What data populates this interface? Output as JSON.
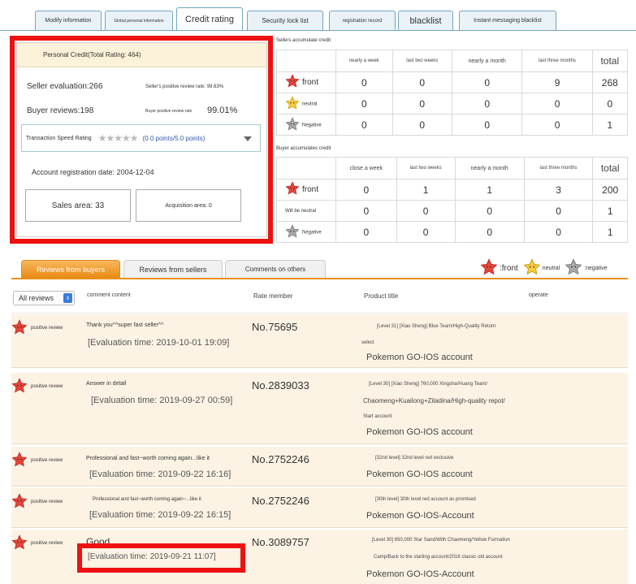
{
  "top_tabs": [
    {
      "label": "Modify information"
    },
    {
      "label": "Global personal information"
    },
    {
      "label": "Credit rating"
    },
    {
      "label": "Security lock list"
    },
    {
      "label": "registration record"
    },
    {
      "label": "blacklist"
    },
    {
      "label": "Instant messaging blacklist"
    }
  ],
  "summary": {
    "title": "Personal Credit(Total Rating: 464)",
    "seller_eval": "Seller evaluation:266",
    "seller_rate_label": "Seller's positive review rate: 99.63%",
    "buyer_reviews": "Buyer reviews:198",
    "buyer_rate_label": "Buyer positive review rate",
    "buyer_rate": "99.01%",
    "speed_label": "Transaction Speed Rating",
    "speed_value": "(0.0 points/5.0 points)",
    "speed_stars": 0,
    "reg_date": "Account registration date: 2004-12-04",
    "sales_area": "Sales area: 33",
    "acq_area": "Acquisition area: 0"
  },
  "seller_credit": {
    "title": "Sellers accumulate credit",
    "headers": [
      "nearly a week",
      "last two weeks",
      "nearly a month",
      "last three months",
      "total"
    ],
    "rows": [
      {
        "label": "front",
        "icon": "red-star-icon",
        "values": [
          "0",
          "0",
          "0",
          "9",
          "268"
        ]
      },
      {
        "label": "neutral",
        "icon": "yellow-star-icon",
        "values": [
          "0",
          "0",
          "0",
          "0",
          "0"
        ]
      },
      {
        "label": "Negative",
        "icon": "gray-star-icon",
        "values": [
          "0",
          "0",
          "0",
          "0",
          "1"
        ]
      }
    ]
  },
  "buyer_credit": {
    "title": "Buyer accumulates credit",
    "headers": [
      "close a week",
      "last two weeks",
      "nearly a month",
      "last three months",
      "total"
    ],
    "rows": [
      {
        "label": "front",
        "icon": "red-star-icon",
        "values": [
          "0",
          "1",
          "1",
          "3",
          "200"
        ]
      },
      {
        "label": "Will be neutral",
        "icon": "",
        "values": [
          "0",
          "0",
          "0",
          "0",
          "1"
        ]
      },
      {
        "label": "Negative",
        "icon": "gray-star-icon",
        "values": [
          "0",
          "0",
          "0",
          "0",
          "1"
        ]
      }
    ]
  },
  "review_tabs": [
    "Reviews from buyers",
    "Reviews from sellers",
    "Comments on others"
  ],
  "legend": {
    "positive": ":front",
    "neutral": "neutral",
    "negative": ":negative"
  },
  "list_header": {
    "filter": "All reviews",
    "comment": "comment content",
    "member": "Rate member",
    "product": "Product title",
    "operate": "operate"
  },
  "reviews": [
    {
      "badge": "positive review",
      "comment": "Thank you^^super fast seller^^",
      "time": "[Evaluation time: 2019-10-01 19:09]",
      "member": "No.75695",
      "product_lines": [
        "[Level 31] [Xiao Sheng] Blue Team/High-Quality Return",
        "select"
      ],
      "product_title": "Pokemon GO-IOS account"
    },
    {
      "badge": "positive review",
      "comment": "Answer in detail",
      "time": "[Evaluation time: 2019-09-27 00:59]",
      "member": "No.2839033",
      "product_lines": [
        "[Level 30] [Xiao Sheng] 760,000 Xingsha/Huang Team/",
        "Chaomeng+Kuailong+Ziladina/High-quality repot/",
        "Start account"
      ],
      "product_title": "Pokemon GO-IOS account"
    },
    {
      "badge": "positive review",
      "comment": "Professional and fast~worth coming again...like it",
      "time": "[Evaluation time: 2019-09-22 16:16]",
      "member": "No.2752246",
      "product_lines": [
        "[32nd level] 32nd level red exclusive"
      ],
      "product_title": "Pokemon GO-IOS account"
    },
    {
      "badge": "positive review",
      "comment": "Professional and fast~worth coming again~...like it",
      "time": "[Evaluation time: 2019-09-22 16:15]",
      "member": "No.2752246",
      "product_lines": [
        "[30th level] 30th level red account as promised"
      ],
      "product_title": "Pokemon GO-IOS-Account"
    },
    {
      "badge": "positive review",
      "comment": "Good",
      "time": "[Evaluation time: 2019-09-21 11:07]",
      "member": "No.3089757",
      "product_lines": [
        "[Level 30] 850,000 Star Sand/With Chaomeng/Yellow Formation",
        "Camp/Back to the starting account/2016 classic old account"
      ],
      "product_title": "Pokemon GO-IOS-Account"
    }
  ],
  "colors": {
    "annotation": "#ee1111",
    "accent": "#e9901a",
    "tab_border": "#6fa6c4",
    "row_bg": "#fcf3e4"
  }
}
